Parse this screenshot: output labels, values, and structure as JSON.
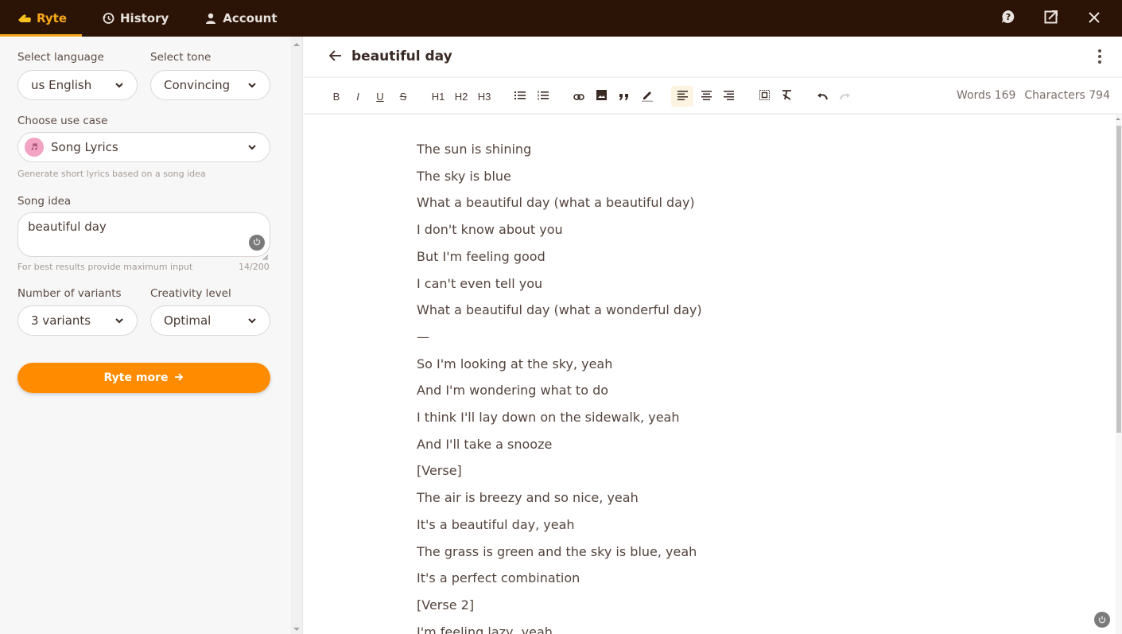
{
  "topbar": {
    "tabs": [
      {
        "label": "Ryte",
        "icon": "ryte-hand-logo-icon",
        "active": true
      },
      {
        "label": "History",
        "icon": "history-icon",
        "active": false
      },
      {
        "label": "Account",
        "icon": "user-icon",
        "active": false
      }
    ],
    "actions": [
      {
        "name": "help",
        "icon": "help-icon"
      },
      {
        "name": "open-external",
        "icon": "external-link-icon"
      },
      {
        "name": "close",
        "icon": "close-icon"
      }
    ],
    "accent_color": "#f7a81b",
    "bg_color": "#2b1306"
  },
  "form": {
    "language": {
      "label": "Select language",
      "value": "us English"
    },
    "tone": {
      "label": "Select tone",
      "value": "Convincing"
    },
    "use_case": {
      "label": "Choose use case",
      "value": "Song Lyrics",
      "icon_text": "♬",
      "helper": "Generate short lyrics based on a song idea"
    },
    "song_idea": {
      "label": "Song idea",
      "value": "beautiful day",
      "helper": "For best results provide maximum input",
      "counter": "14/200"
    },
    "variants": {
      "label": "Number of variants",
      "value": "3 variants"
    },
    "creativity": {
      "label": "Creativity level",
      "value": "Optimal"
    },
    "submit_label": "Ryte more",
    "submit_color": "#ff8c00"
  },
  "editor": {
    "title": "beautiful day",
    "toolbar": {
      "bold": "B",
      "italic": "I",
      "underline": "U",
      "strike": "S",
      "h1": "H1",
      "h2": "H2",
      "h3": "H3"
    },
    "words_label": "Words 169",
    "characters_label": "Characters 794",
    "lines": [
      "The sun is shining",
      "The sky is blue",
      "What a beautiful day (what a beautiful day)",
      "I don't know about you",
      "But I'm feeling good",
      "I can't even tell you",
      "What a beautiful day (what a wonderful day)",
      "—",
      "So I'm looking at the sky, yeah",
      "And I'm wondering what to do",
      "I think I'll lay down on the sidewalk, yeah",
      "And I'll take a snooze",
      "[Verse]",
      "The air is breezy and so nice, yeah",
      "It's a beautiful day, yeah",
      "The grass is green and the sky is blue, yeah",
      "It's a perfect combination",
      "[Verse 2]",
      "I'm feeling lazy, yeah"
    ]
  }
}
